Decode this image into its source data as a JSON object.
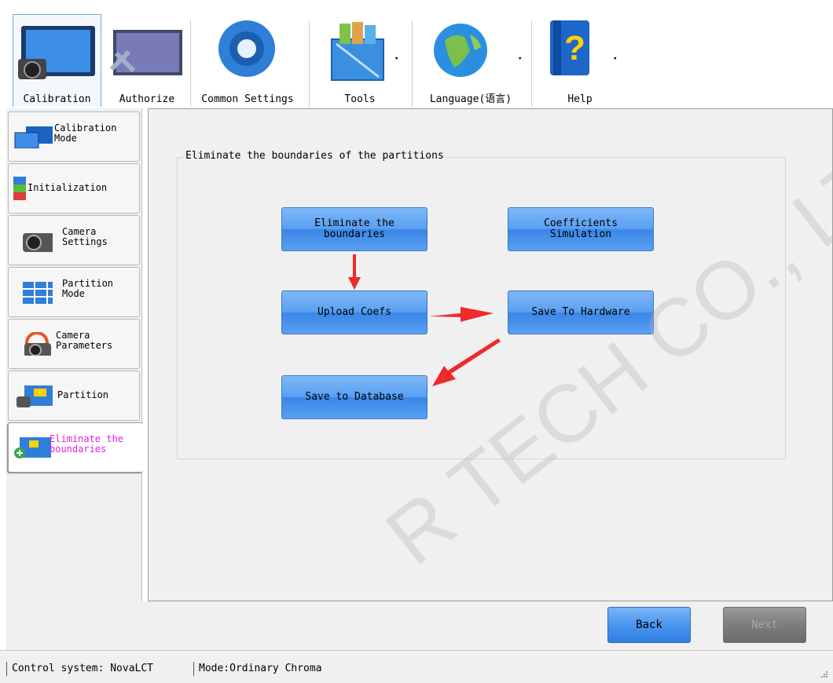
{
  "toolbar": {
    "items": [
      {
        "label": "Calibration",
        "icon": "calibration-monitor-camera-icon"
      },
      {
        "label": "Authorize",
        "icon": "authorize-monitor-tools-icon"
      },
      {
        "label": "Common Settings",
        "icon": "gear-icon"
      },
      {
        "label": "Tools",
        "icon": "toolbox-icon"
      },
      {
        "label": "Language(语言)",
        "icon": "globe-icon"
      },
      {
        "label": "Help",
        "icon": "help-book-icon"
      }
    ],
    "dropdown_glyph": "▾"
  },
  "sidebar": {
    "items": [
      {
        "label": "Calibration\nMode",
        "icon": "calibration-mode-icon"
      },
      {
        "label": "Initialization",
        "icon": "initialization-icon"
      },
      {
        "label": "Camera\nSettings",
        "icon": "camera-settings-icon"
      },
      {
        "label": "Partition\nMode",
        "icon": "partition-mode-icon"
      },
      {
        "label": "Camera\nParameters",
        "icon": "camera-parameters-icon"
      },
      {
        "label": "Partition",
        "icon": "partition-icon"
      },
      {
        "label": "Eliminate the\nboundaries",
        "icon": "eliminate-boundaries-icon",
        "active": true
      }
    ]
  },
  "main": {
    "group_title": "Eliminate the boundaries of the partitions",
    "buttons": {
      "eliminate": "Eliminate the\nboundaries",
      "coefficients": "Coefficients\nSimulation",
      "upload": "Upload Coefs",
      "save_hardware": "Save To Hardware",
      "save_database": "Save to Database"
    }
  },
  "nav": {
    "back": "Back",
    "next": "Next"
  },
  "status": {
    "control_system": "Control system: NovaLCT",
    "mode": "Mode:Ordinary Chroma"
  },
  "watermark": "R TECH CO., LTD",
  "colors": {
    "button_blue": "#5aa0f2",
    "arrow_red": "#ee2a2a",
    "active_text": "#e21ee2"
  }
}
